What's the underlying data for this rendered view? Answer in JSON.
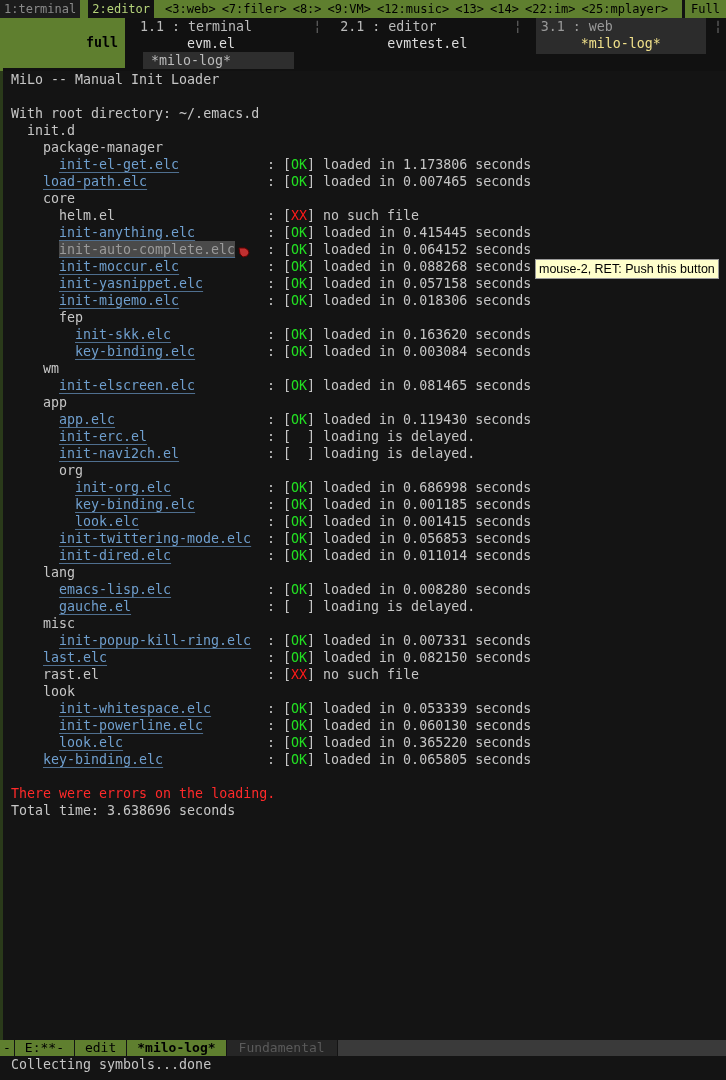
{
  "frame_tabs": [
    {
      "label": "1:terminal",
      "kind": "window",
      "selected": false
    },
    {
      "label": "2:editor",
      "kind": "window",
      "selected": true
    },
    {
      "label": "<3:web>",
      "kind": "hidden"
    },
    {
      "label": "<7:filer>",
      "kind": "hidden"
    },
    {
      "label": "<8:>",
      "kind": "hidden"
    },
    {
      "label": "<9:VM>",
      "kind": "hidden"
    },
    {
      "label": "<12:music>",
      "kind": "hidden"
    },
    {
      "label": "<13>",
      "kind": "hidden"
    },
    {
      "label": "<14>",
      "kind": "hidden"
    },
    {
      "label": "<22:im>",
      "kind": "hidden"
    },
    {
      "label": "<25:mplayer>",
      "kind": "hidden"
    }
  ],
  "layout_label": "Full",
  "mode_block": "full",
  "panes": [
    {
      "title": "1.1 : terminal",
      "buffers": [
        {
          "name": "evm.el",
          "selected": false
        },
        {
          "name": "*milo-log*",
          "selected": true
        }
      ],
      "selected": false
    },
    {
      "title": "2.1 : editor",
      "buffers": [
        {
          "name": "evmtest.el",
          "selected": false
        }
      ],
      "selected": false
    },
    {
      "title": "3.1 : web",
      "buffers": [
        {
          "name": "*milo-log*",
          "selected": false
        }
      ],
      "selected": true
    }
  ],
  "pane_separator": "¦",
  "header": "MiLo -- Manual Init Loader",
  "root_line": "With root directory: ~/.emacs.d",
  "tree": [
    {
      "label": "init.d",
      "kind": "dir",
      "children": [
        {
          "label": "package-manager",
          "kind": "dir",
          "children": [
            {
              "label": "init-el-get.elc",
              "kind": "link",
              "sep": ":",
              "flag": "[OK]",
              "color": "#22e022",
              "message": "loaded in 1.173806 seconds"
            }
          ]
        },
        {
          "label": "load-path.elc",
          "kind": "link",
          "sep": ":",
          "flag": "[OK]",
          "color": "#22e022",
          "message": "loaded in 0.007465 seconds"
        },
        {
          "label": "core",
          "kind": "dir",
          "children": [
            {
              "label": "helm.el",
              "kind": "plain",
              "sep": ":",
              "flag": "[XX]",
              "color": "#ff1a1a",
              "message": "no such file"
            },
            {
              "label": "init-anything.elc",
              "kind": "link",
              "sep": ":",
              "flag": "[OK]",
              "color": "#22e022",
              "message": "loaded in 0.415445 seconds"
            },
            {
              "label": "init-auto-complete.elc",
              "kind": "link",
              "hovered": true,
              "sep": ":",
              "flag": "[OK]",
              "color": "#22e022",
              "message": "loaded in 0.064152 seconds"
            },
            {
              "label": "init-moccur.elc",
              "kind": "link",
              "sep": ":",
              "flag": "[OK]",
              "color": "#22e022",
              "message": "loaded in 0.088268 seconds"
            },
            {
              "label": "init-yasnippet.elc",
              "kind": "link",
              "sep": ":",
              "flag": "[OK]",
              "color": "#22e022",
              "message": "loaded in 0.057158 seconds"
            },
            {
              "label": "init-migemo.elc",
              "kind": "link",
              "sep": ":",
              "flag": "[OK]",
              "color": "#22e022",
              "message": "loaded in 0.018306 seconds"
            },
            {
              "label": "fep",
              "kind": "dir",
              "children": [
                {
                  "label": "init-skk.elc",
                  "kind": "link",
                  "sep": ":",
                  "flag": "[OK]",
                  "color": "#22e022",
                  "message": "loaded in 0.163620 seconds"
                },
                {
                  "label": "key-binding.elc",
                  "kind": "link",
                  "sep": ":",
                  "flag": "[OK]",
                  "color": "#22e022",
                  "message": "loaded in 0.003084 seconds"
                }
              ]
            }
          ]
        },
        {
          "label": "wm",
          "kind": "dir",
          "children": [
            {
              "label": "init-elscreen.elc",
              "kind": "link",
              "sep": ":",
              "flag": "[OK]",
              "color": "#22e022",
              "message": "loaded in 0.081465 seconds"
            }
          ]
        },
        {
          "label": "app",
          "kind": "dir",
          "children": [
            {
              "label": "app.elc",
              "kind": "link",
              "sep": ":",
              "flag": "[OK]",
              "color": "#22e022",
              "message": "loaded in 0.119430 seconds"
            },
            {
              "label": "init-erc.el",
              "kind": "link",
              "sep": ":",
              "flag": "[  ]",
              "message": "loading is delayed."
            },
            {
              "label": "init-navi2ch.el",
              "kind": "link",
              "sep": ":",
              "flag": "[  ]",
              "message": "loading is delayed."
            },
            {
              "label": "org",
              "kind": "dir",
              "children": [
                {
                  "label": "init-org.elc",
                  "kind": "link",
                  "sep": ":",
                  "flag": "[OK]",
                  "color": "#22e022",
                  "message": "loaded in 0.686998 seconds"
                },
                {
                  "label": "key-binding.elc",
                  "kind": "link",
                  "sep": ":",
                  "flag": "[OK]",
                  "color": "#22e022",
                  "message": "loaded in 0.001185 seconds"
                },
                {
                  "label": "look.elc",
                  "kind": "link",
                  "sep": ":",
                  "flag": "[OK]",
                  "color": "#22e022",
                  "message": "loaded in 0.001415 seconds"
                }
              ]
            },
            {
              "label": "init-twittering-mode.elc",
              "kind": "link",
              "sep": ":",
              "flag": "[OK]",
              "color": "#22e022",
              "message": "loaded in 0.056853 seconds"
            },
            {
              "label": "init-dired.elc",
              "kind": "link",
              "sep": ":",
              "flag": "[OK]",
              "color": "#22e022",
              "message": "loaded in 0.011014 seconds"
            }
          ]
        },
        {
          "label": "lang",
          "kind": "dir",
          "children": [
            {
              "label": "emacs-lisp.elc",
              "kind": "link",
              "sep": ":",
              "flag": "[OK]",
              "color": "#22e022",
              "message": "loaded in 0.008280 seconds"
            },
            {
              "label": "gauche.el",
              "kind": "link",
              "sep": ":",
              "flag": "[  ]",
              "message": "loading is delayed."
            }
          ]
        },
        {
          "label": "misc",
          "kind": "dir",
          "children": [
            {
              "label": "init-popup-kill-ring.elc",
              "kind": "link",
              "sep": ":",
              "flag": "[OK]",
              "color": "#22e022",
              "message": "loaded in 0.007331 seconds"
            }
          ]
        },
        {
          "label": "last.elc",
          "kind": "link",
          "sep": ":",
          "flag": "[OK]",
          "color": "#22e022",
          "message": "loaded in 0.082150 seconds"
        },
        {
          "label": "rast.el",
          "kind": "plain",
          "sep": ":",
          "flag": "[XX]",
          "color": "#ff1a1a",
          "message": "no such file"
        },
        {
          "label": "look",
          "kind": "dir",
          "children": [
            {
              "label": "init-whitespace.elc",
              "kind": "link",
              "sep": ":",
              "flag": "[OK]",
              "color": "#22e022",
              "message": "loaded in 0.053339 seconds"
            },
            {
              "label": "init-powerline.elc",
              "kind": "link",
              "sep": ":",
              "flag": "[OK]",
              "color": "#22e022",
              "message": "loaded in 0.060130 seconds"
            },
            {
              "label": "look.elc",
              "kind": "link",
              "sep": ":",
              "flag": "[OK]",
              "color": "#22e022",
              "message": "loaded in 0.365220 seconds"
            }
          ]
        },
        {
          "label": "key-binding.elc",
          "kind": "link",
          "sep": ":",
          "flag": "[OK]",
          "color": "#22e022",
          "message": "loaded in 0.065805 seconds"
        }
      ]
    }
  ],
  "error_line": "There were errors on the loading.",
  "total_line": "Total time: 3.638696 seconds",
  "tooltip": "mouse-2, RET: Push this button",
  "mode_line": [
    {
      "label": "-",
      "kind": "edge"
    },
    {
      "label": "E:**-",
      "kind": "status"
    },
    {
      "label": "edit",
      "kind": "status"
    },
    {
      "label": "*milo-log*",
      "kind": "buffer"
    },
    {
      "label": "Fundamental",
      "kind": "mode"
    }
  ],
  "echo": "Collecting symbols...done"
}
